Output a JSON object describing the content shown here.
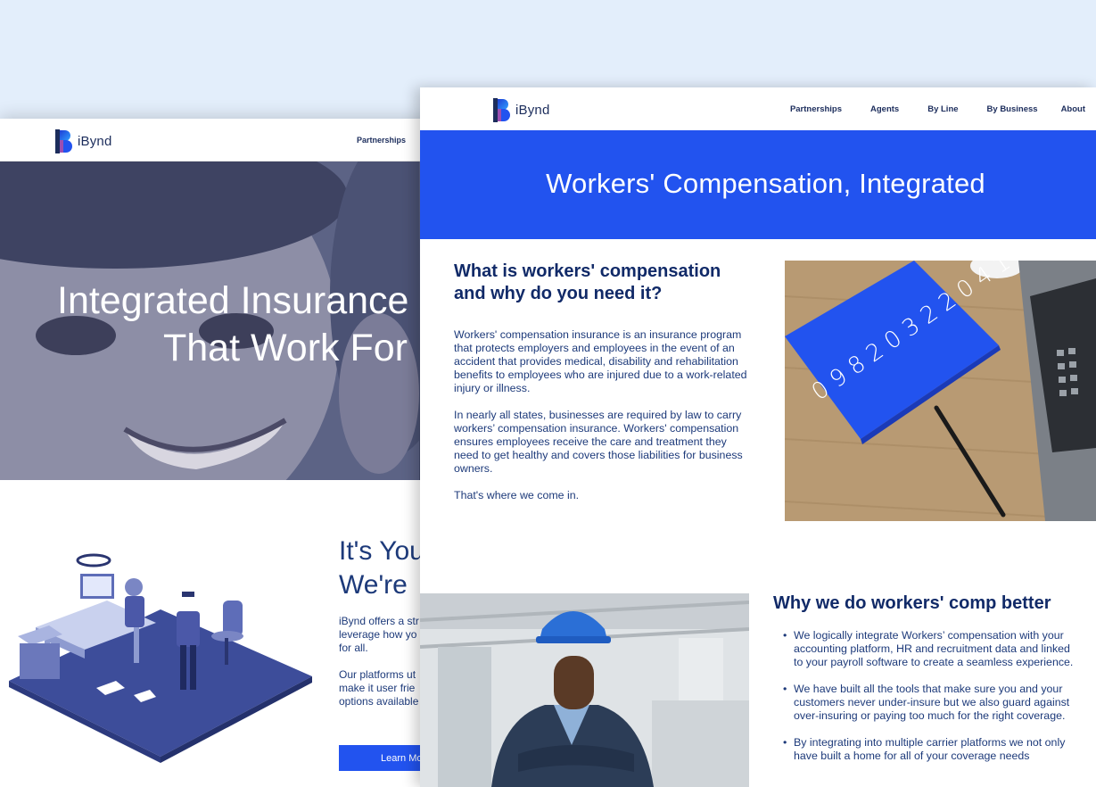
{
  "brand": {
    "name": "iBynd",
    "primary": "#2253ef",
    "navy": "#112a68"
  },
  "back_page": {
    "nav": {
      "partnerships": "Partnerships"
    },
    "hero": {
      "line1": "Integrated Insurance",
      "line2": "That Work For"
    },
    "section": {
      "title_line1": "It's You",
      "title_line2": "We're",
      "p1_lines": [
        "iBynd offers a str",
        "leverage how yo",
        "for all."
      ],
      "p2_lines": [
        "Our platforms ut",
        "make it user frie",
        "options available"
      ],
      "button": "Learn Mo"
    }
  },
  "front_page": {
    "nav": [
      "Partnerships",
      "Agents",
      "By Line",
      "By Business",
      "About"
    ],
    "banner_title": "Workers' Compensation, Integrated",
    "what": {
      "title": "What is workers' compensation and why do you need it?",
      "paragraphs": [
        "Workers' compensation insurance is an insurance program that protects employers and employees in the event of an accident that provides medical, disability and rehabilitation benefits to employees who are injured due to a work-related injury or illness.",
        "In nearly all states, businesses are required by law to carry workers’ compensation insurance. Workers' compensation ensures employees receive the care and treatment they need to get healthy and covers those liabilities for business owners.",
        "That's where we come in."
      ]
    },
    "notebook_digits": "0 9 8 2 0 3 2 2 0 4 1",
    "why": {
      "title": "Why we do workers' comp better",
      "items": [
        "We logically integrate Workers’ compensation with your accounting platform, HR and recruitment data and linked to your payroll software to create a seamless experience.",
        "We have built all the tools that make sure you and your customers never under-insure but we also guard against over-insuring or paying too much for the right coverage.",
        "By integrating into multiple carrier platforms we not only have built a home for all of your coverage needs"
      ]
    }
  }
}
